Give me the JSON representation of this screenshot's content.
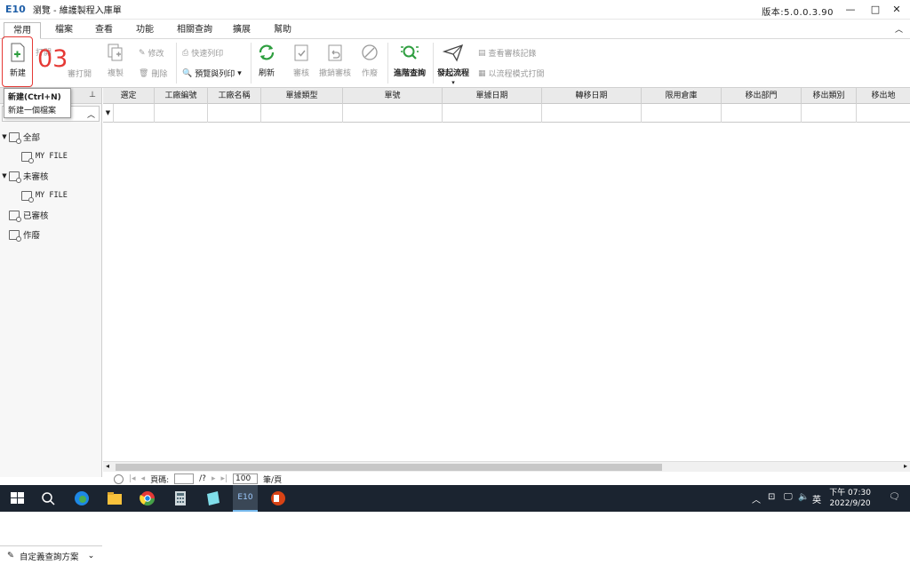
{
  "window": {
    "logo": "E10",
    "title": "瀏覽 - 維護製程入庫單",
    "version": "版本:5.0.0.3.90",
    "controls": [
      "—",
      "□",
      "✕"
    ]
  },
  "tabs": [
    "常用",
    "檔案",
    "查看",
    "功能",
    "相關查詢",
    "擴展",
    "幫助"
  ],
  "ribbon": {
    "new": "新建",
    "copy": "複製",
    "edit": "修改",
    "delete": "刪除",
    "quick_print": "快速列印",
    "preview_print": "預覽與列印",
    "refresh": "刷新",
    "review": "審核",
    "undo_review": "撤銷審核",
    "void": "作廢",
    "advanced_query": "進階查詢",
    "start_flow": "發起流程",
    "view_review_log": "查看審核記錄",
    "flow_print": "以流程模式打開",
    "hidden_1": "打開",
    "hidden_2": "審打開"
  },
  "annotation": "03",
  "tooltip": {
    "title": "新建(Ctrl+N)",
    "desc": "新建一個檔案"
  },
  "left_panel": {
    "tree": [
      {
        "label": "全部",
        "level": 0,
        "expanded": true
      },
      {
        "label": "MY FILE",
        "level": 1
      },
      {
        "label": "未審核",
        "level": 0,
        "expanded": true
      },
      {
        "label": "MY FILE",
        "level": 1
      },
      {
        "label": "已審核",
        "level": 0
      },
      {
        "label": "作廢",
        "level": 0
      }
    ],
    "scheme": "自定義查詢方案"
  },
  "grid": {
    "columns": [
      "選定",
      "工廠編號",
      "工廠名稱",
      "單據類型",
      "單號",
      "單據日期",
      "轉移日期",
      "限用倉庫",
      "移出部門",
      "移出類別",
      "移出地"
    ]
  },
  "pager": {
    "page_label": "頁碼:",
    "total": "/?",
    "per_page": "100",
    "per_page_unit": "筆/頁"
  },
  "taskbar": {
    "time": "下午 07:30",
    "date": "2022/9/20",
    "ime": "英"
  }
}
